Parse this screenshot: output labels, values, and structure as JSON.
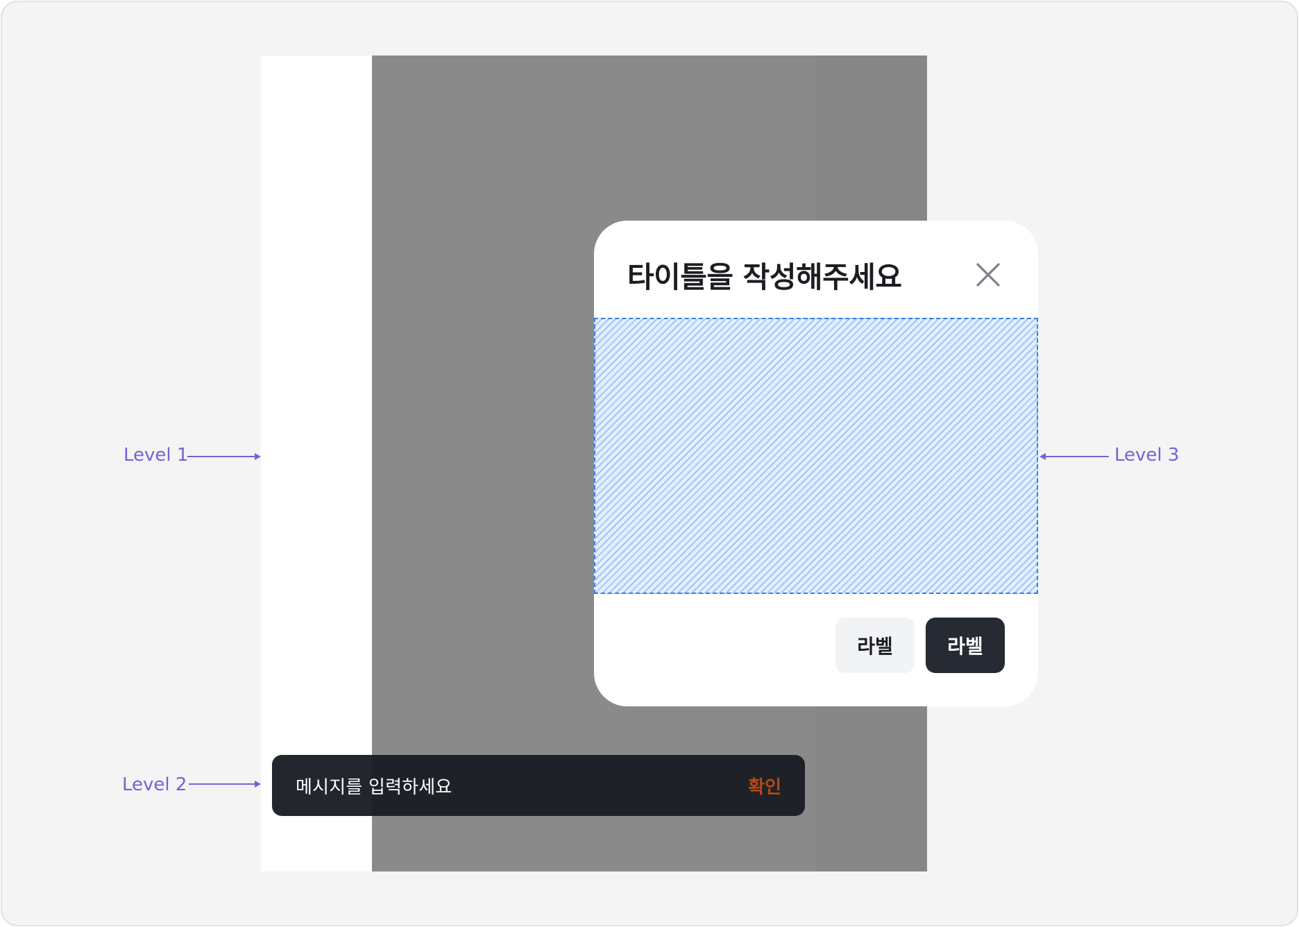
{
  "dialog": {
    "title": "타이틀을 작성해주세요",
    "secondary_button": "라벨",
    "primary_button": "라벨",
    "close_icon": "close-icon"
  },
  "toast": {
    "message": "메시지를 입력하세요",
    "action": "확인"
  },
  "annotations": {
    "level1": "Level 1",
    "level2": "Level 2",
    "level3": "Level 3"
  },
  "colors": {
    "annotation": "#7b5fd6",
    "toast_action": "#b54a12",
    "primary_button": "#262b33",
    "slot_border": "#3a7de0"
  }
}
